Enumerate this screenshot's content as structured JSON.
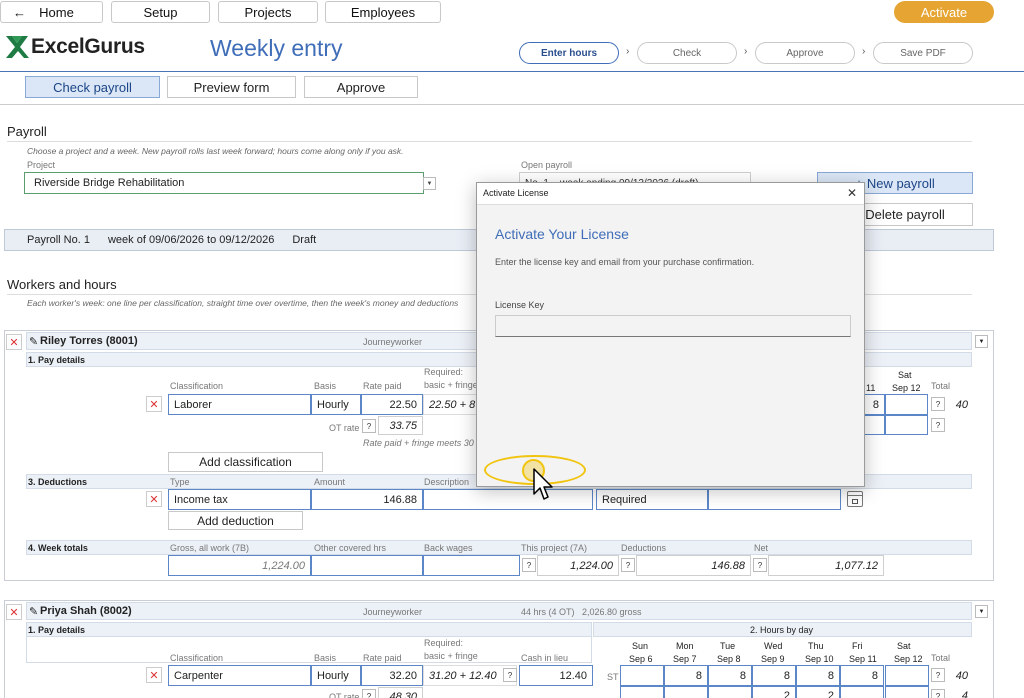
{
  "nav": {
    "home": "Home",
    "setup": "Setup",
    "projects": "Projects",
    "employees": "Employees",
    "activate": "Activate"
  },
  "brand": {
    "logo_text": "ExcelGurus",
    "page_title": "Weekly entry",
    "accent": "#3f6db8"
  },
  "steps": [
    "Enter hours",
    "Check",
    "Approve",
    "Save PDF"
  ],
  "tabs": [
    "Check payroll",
    "Preview form",
    "Approve"
  ],
  "payroll": {
    "heading": "Payroll",
    "hint": "Choose a project and a week. New payroll rolls last week forward; hours come along only if you ask.",
    "project_label": "Project",
    "project_value": "Riverside Bridge Rehabilitation",
    "open_label": "Open payroll",
    "open_value": "No. 1 – week ending 09/12/2026 (draft)",
    "new_button": "New payroll",
    "delete_button": "Delete payroll",
    "summary_no": "Payroll No. 1",
    "summary_week": "week of 09/06/2026 to 09/12/2026",
    "summary_status": "Draft"
  },
  "workers_section": {
    "heading": "Workers and hours",
    "hint": "Each worker's week: one line per classification, straight time over overtime, then the week's money and deductions"
  },
  "labels": {
    "pay_details": "1. Pay details",
    "deductions": "3. Deductions",
    "week_totals": "4. Week totals",
    "hours_by_day": "2. Hours by day",
    "classification": "Classification",
    "basis": "Basis",
    "rate_paid": "Rate paid",
    "required": "Required:",
    "basic_fringe": "basic + fringe",
    "cash_in_lieu": "Cash in lieu",
    "ot_rate": "OT rate",
    "total": "Total",
    "type": "Type",
    "amount": "Amount",
    "description": "Description",
    "gross_all": "Gross, all work (7B)",
    "other_hrs": "Other covered hrs",
    "back_wages": "Back wages",
    "this_project": "This project (7A)",
    "deductions_col": "Deductions",
    "net": "Net",
    "add_classification": "Add classification",
    "add_deduction": "Add deduction",
    "st": "ST",
    "q": "?",
    "x": "✕"
  },
  "days": [
    {
      "d": "Sun",
      "date": "Sep 6"
    },
    {
      "d": "Mon",
      "date": "Sep 7"
    },
    {
      "d": "Tue",
      "date": "Sep 8"
    },
    {
      "d": "Wed",
      "date": "Sep 9"
    },
    {
      "d": "Thu",
      "date": "Sep 10"
    },
    {
      "d": "Fri",
      "date": "Sep 11"
    },
    {
      "d": "Sat",
      "date": "Sep 12"
    }
  ],
  "worker1": {
    "name": "Riley Torres (8001)",
    "role": "Journeyworker",
    "classification": "Laborer",
    "basis": "Hourly",
    "rate": "22.50",
    "required": "22.50 + 8",
    "ot_rate": "33.75",
    "note": "Rate paid + fringe meets 30",
    "fri": "8",
    "total": "40",
    "fri_short": "11",
    "ded_type": "Income tax",
    "ded_amount": "146.88",
    "ded_req": "Required",
    "gross": "1,224.00",
    "this_project": "1,224.00",
    "ded_total": "146.88",
    "net": "1,077.12"
  },
  "worker2": {
    "name": "Priya Shah (8002)",
    "role": "Journeyworker",
    "summary": "44 hrs (4 OT)   2,026.80 gross",
    "classification": "Carpenter",
    "basis": "Hourly",
    "rate": "32.20",
    "required": "31.20 + 12.40",
    "cash": "12.40",
    "ot_rate": "48.30",
    "hours": [
      "",
      "8",
      "8",
      "8",
      "8",
      "8",
      ""
    ],
    "ot_hours": [
      "",
      "",
      "",
      "2",
      "2",
      "",
      ""
    ],
    "total": "40",
    "ot_total": "4"
  },
  "modal": {
    "window_title": "Activate License",
    "heading": "Activate Your License",
    "body": "Enter the license key and email from your purchase confirmation.",
    "key_label": "License Key",
    "close": "✕"
  }
}
